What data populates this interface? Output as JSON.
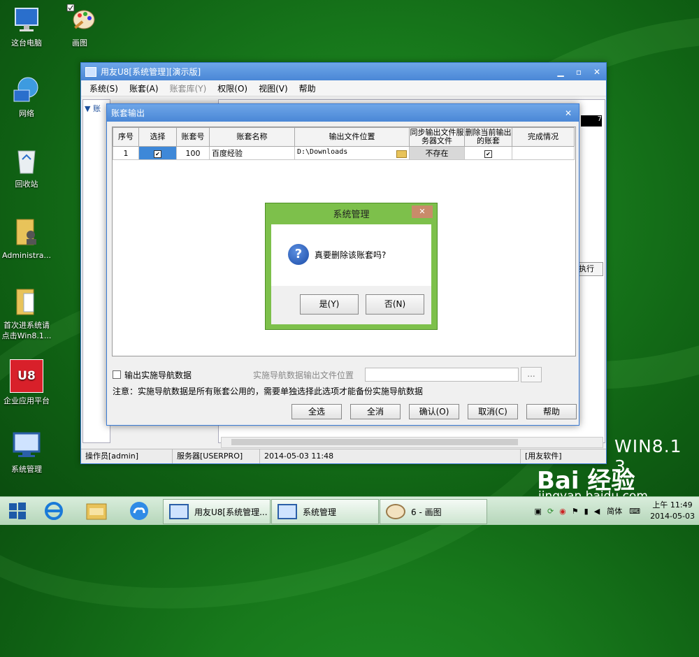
{
  "desktop": {
    "icons": [
      {
        "label": "这台电脑"
      },
      {
        "label": "画图"
      },
      {
        "label": "网络"
      },
      {
        "label": "回收站"
      },
      {
        "label": "Administra..."
      },
      {
        "label": "首次进系统请点击Win8.1..."
      },
      {
        "label": "企业应用平台"
      },
      {
        "label": "系统管理"
      }
    ],
    "u8_logo_text": "U8",
    "watermark_win": "WIN8.1 3",
    "watermark_baidu": "Bai 经验",
    "watermark_url": "jingyan.baidu.com"
  },
  "main_window": {
    "title": "用友U8[系统管理][演示版]",
    "menu": [
      "系统(S)",
      "账套(A)",
      "账套库(Y)",
      "权限(O)",
      "视图(V)",
      "帮助"
    ],
    "tree_item": "账",
    "black_cell_text": "7",
    "exec_button": "执行",
    "status": {
      "operator": "操作员[admin]",
      "server": "服务器[USERPRO]",
      "datetime": "2014-05-03 11:48",
      "company": "[用友软件]"
    }
  },
  "export_dialog": {
    "title": "账套输出",
    "columns": [
      "序号",
      "选择",
      "账套号",
      "账套名称",
      "输出文件位置",
      "同步输出文件服务器文件",
      "删除当前输出的账套",
      "完成情况"
    ],
    "rows": [
      {
        "no": "1",
        "selected": true,
        "account_no": "100",
        "name": "百度经验",
        "path": "D:\\Downloads",
        "sync": "不存在",
        "delete": true,
        "status": ""
      }
    ],
    "nav_checkbox_label": "输出实施导航数据",
    "nav_path_label": "实施导航数据输出文件位置",
    "nav_path_value": "",
    "browse_label": "...",
    "note": "注意：实施导航数据是所有账套公用的，需要单独选择此选项才能备份实施导航数据",
    "buttons": {
      "select_all": "全选",
      "deselect_all": "全消",
      "confirm": "确认(O)",
      "cancel": "取消(C)",
      "help": "帮助"
    }
  },
  "message_box": {
    "title": "系统管理",
    "text": "真要删除该账套吗?",
    "yes": "是(Y)",
    "no": "否(N)",
    "icon_glyph": "?"
  },
  "taskbar": {
    "tasks": [
      "用友U8[系统管理...",
      "系统管理",
      "6 - 画图"
    ],
    "ime": "简体",
    "time": "11:49",
    "time_prefix": "上午",
    "date": "2014-05-03"
  },
  "colors": {
    "desktop_green": "#187a1c",
    "titlebar_blue": "#4a87d6",
    "msgbox_green": "#7dc04b",
    "selection_blue": "#3e88d8"
  }
}
